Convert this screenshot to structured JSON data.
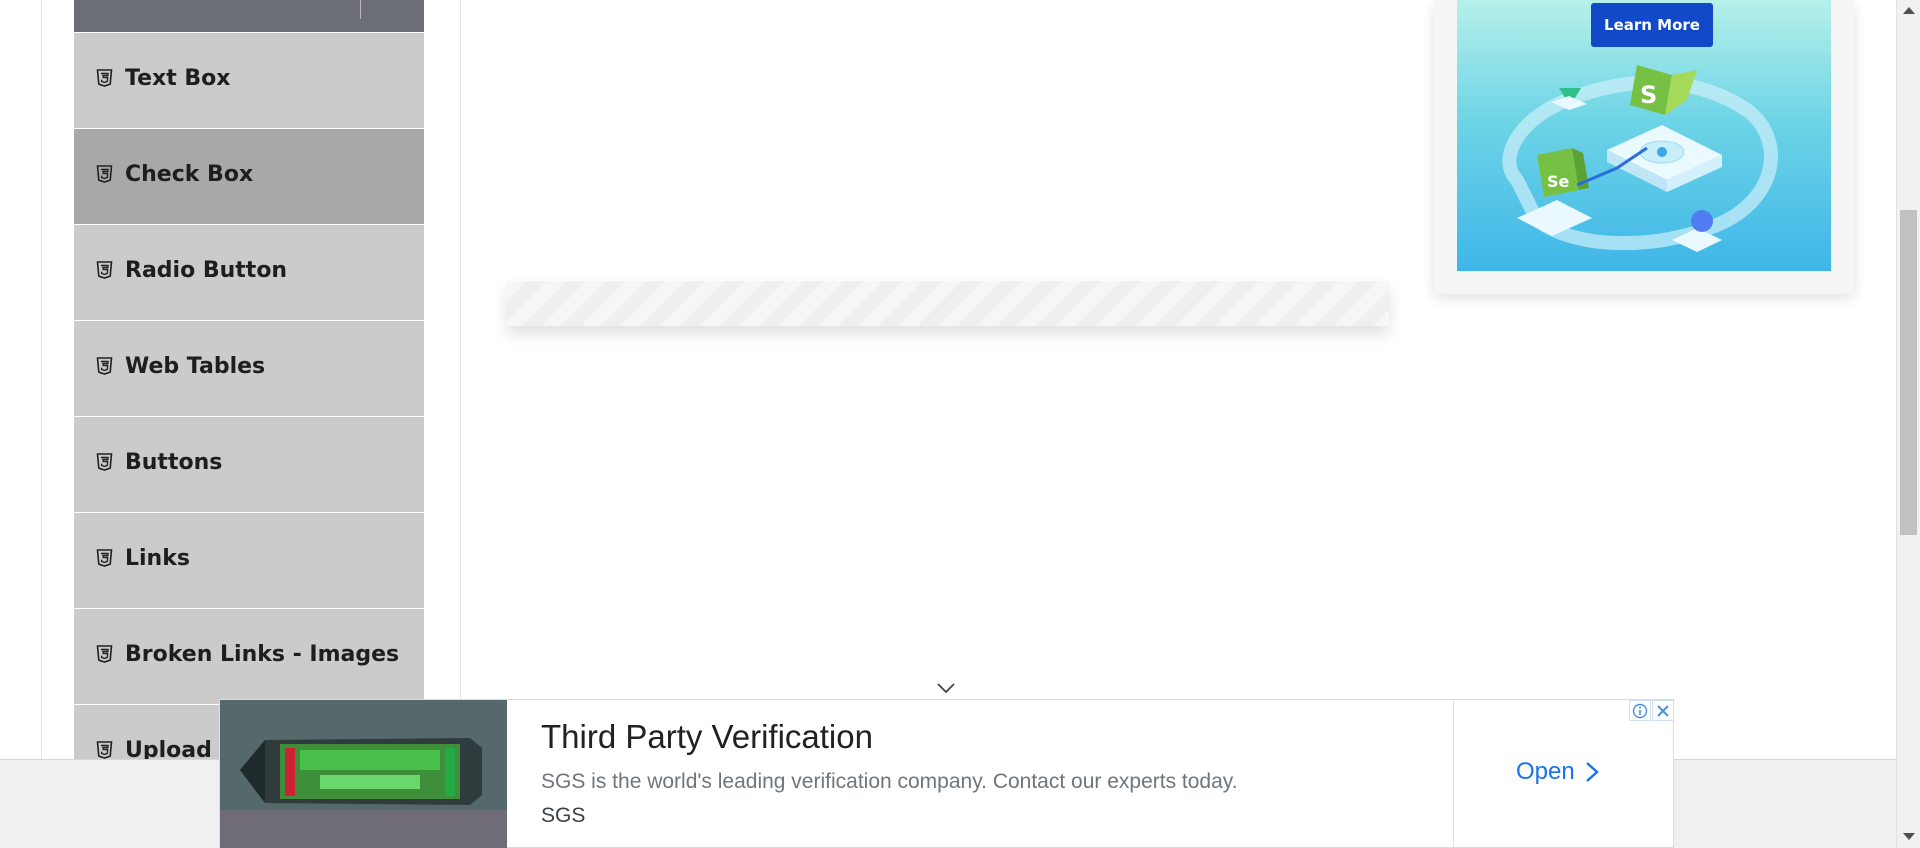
{
  "sidebar": {
    "items": [
      {
        "label": "Text Box",
        "icon": "html5-icon"
      },
      {
        "label": "Check Box",
        "icon": "html5-icon",
        "active": true
      },
      {
        "label": "Radio Button",
        "icon": "html5-icon"
      },
      {
        "label": "Web Tables",
        "icon": "html5-icon"
      },
      {
        "label": "Buttons",
        "icon": "html5-icon"
      },
      {
        "label": "Links",
        "icon": "html5-icon"
      },
      {
        "label": "Broken Links - Images",
        "icon": "html5-icon"
      },
      {
        "label": "Upload and Download",
        "icon": "html5-icon"
      }
    ]
  },
  "side_ad": {
    "button_label": "Learn More",
    "badge_s": "S",
    "badge_se": "Se"
  },
  "banner_ad": {
    "title": "Third Party Verification",
    "description": "SGS is the world's leading verification company. Contact our experts today.",
    "source": "SGS",
    "cta": "Open",
    "adchoices_icon": "info-icon",
    "close_icon": "close-icon"
  },
  "colors": {
    "menu_bg": "#cbcbcb",
    "menu_active_bg": "#a8a8a8",
    "menu_header": "#6b6e74",
    "cta_blue": "#1a73e8",
    "learn_more_bg": "#1149c8"
  }
}
